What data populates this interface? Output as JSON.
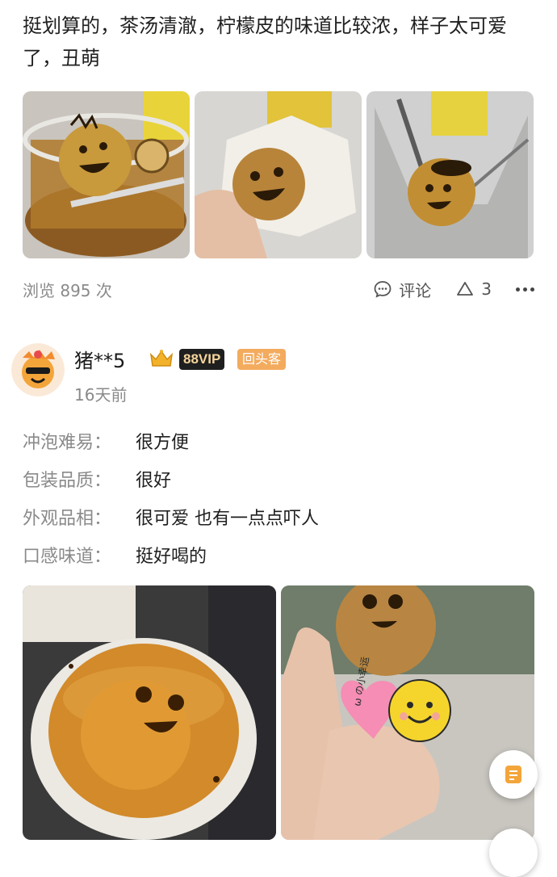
{
  "review": {
    "text": "挺划算的，茶汤清澈，柠檬皮的味道比较浓，样子太可爱了，丑萌"
  },
  "stats": {
    "views": "浏览 895 次",
    "comment_label": "评论",
    "like_count": "3"
  },
  "user": {
    "name": "猪**5",
    "vip_badge": "88VIP",
    "repeat_badge": "回头客",
    "time_ago": "16天前"
  },
  "attributes": [
    {
      "key": "冲泡难易：",
      "value": "很方便"
    },
    {
      "key": "包装品质：",
      "value": "很好"
    },
    {
      "key": "外观品相：",
      "value": "很可爱 也有一点点吓人"
    },
    {
      "key": "口感味道：",
      "value": "挺好喝的"
    }
  ],
  "sticker": {
    "text": "ω の小幸运"
  },
  "colors": {
    "accent": "#f3ab5e",
    "vip_bg": "#1f1f1f",
    "vip_text": "#f5d49b",
    "muted": "#8a8a8a",
    "float_icon": "#f3a53a"
  },
  "icons": {
    "comment": "comment-bubble-icon",
    "like": "triangle-like-icon",
    "more": "more-dots-icon",
    "crown": "crown-icon",
    "float": "note-icon"
  }
}
